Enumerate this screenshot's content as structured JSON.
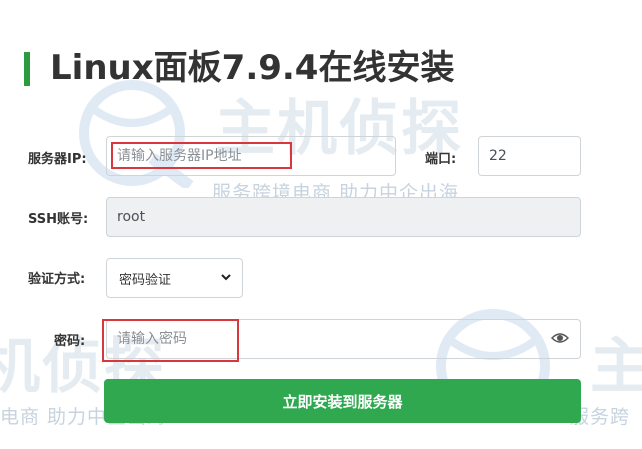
{
  "title": "Linux面板7.9.4在线安装",
  "form": {
    "server_ip": {
      "label": "服务器IP:",
      "placeholder": "请输入服务器IP地址",
      "value": ""
    },
    "port": {
      "label": "端口:",
      "value": "22"
    },
    "ssh_account": {
      "label": "SSH账号:",
      "value": "root"
    },
    "auth_method": {
      "label": "验证方式:",
      "selected": "密码验证"
    },
    "password": {
      "label": "密码:",
      "placeholder": "请输入密码",
      "value": ""
    },
    "submit_label": "立即安装到服务器"
  },
  "watermark": {
    "brand": "主机侦探",
    "slogan_1": "服务跨境电商 助力中企出海",
    "slogan_2": "电商 助力中企出海",
    "slogan_3": "服务跨"
  },
  "colors": {
    "accent": "#2e9a3f",
    "button": "#2fa84f",
    "highlight": "#d9363e"
  }
}
